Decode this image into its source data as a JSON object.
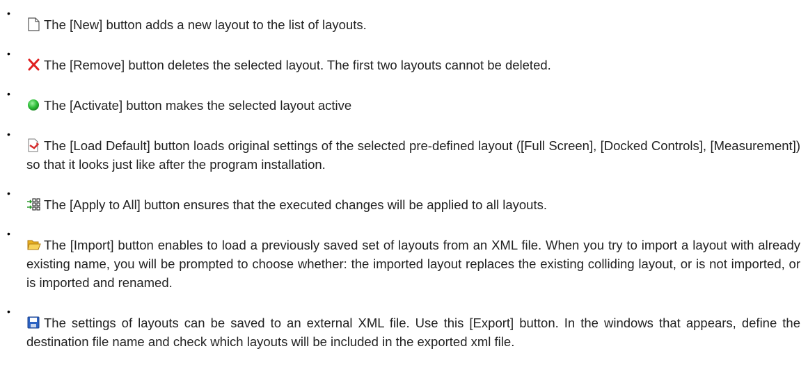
{
  "bullets": [
    {
      "icon": "new-document-icon",
      "text": "The [New] button adds a new layout to the list of layouts."
    },
    {
      "icon": "remove-x-icon",
      "text": "The [Remove] button deletes the selected layout. The first two layouts cannot be deleted."
    },
    {
      "icon": "green-dot-icon",
      "text": "The [Activate] button makes the selected layout active"
    },
    {
      "icon": "load-default-icon",
      "text": "The [Load Default] button loads original settings of the selected pre-defined layout ([Full Screen], [Docked Controls], [Measurement]) so that it looks just like after the program installation."
    },
    {
      "icon": "apply-to-all-icon",
      "text": "The [Apply to All] button ensures that the executed changes will be applied to all layouts."
    },
    {
      "icon": "open-folder-icon",
      "text": "The [Import] button enables to load a previously saved set of layouts from an XML file. When you try to import a layout with already existing name, you will be prompted to choose whether: the imported layout replaces the existing colliding layout, or is not imported, or is imported and renamed."
    },
    {
      "icon": "save-floppy-icon",
      "text": "The settings of layouts can be saved to an external XML file. Use this [Export] button. In the windows that appears, define the destination file name and check which layouts will be included in the exported xml file."
    }
  ],
  "colors": {
    "text": "#222222",
    "remove_x": "#e02020",
    "activate_green": "#2fbf3a",
    "folder_yellow": "#f2c230",
    "floppy_blue": "#2c63c4"
  }
}
